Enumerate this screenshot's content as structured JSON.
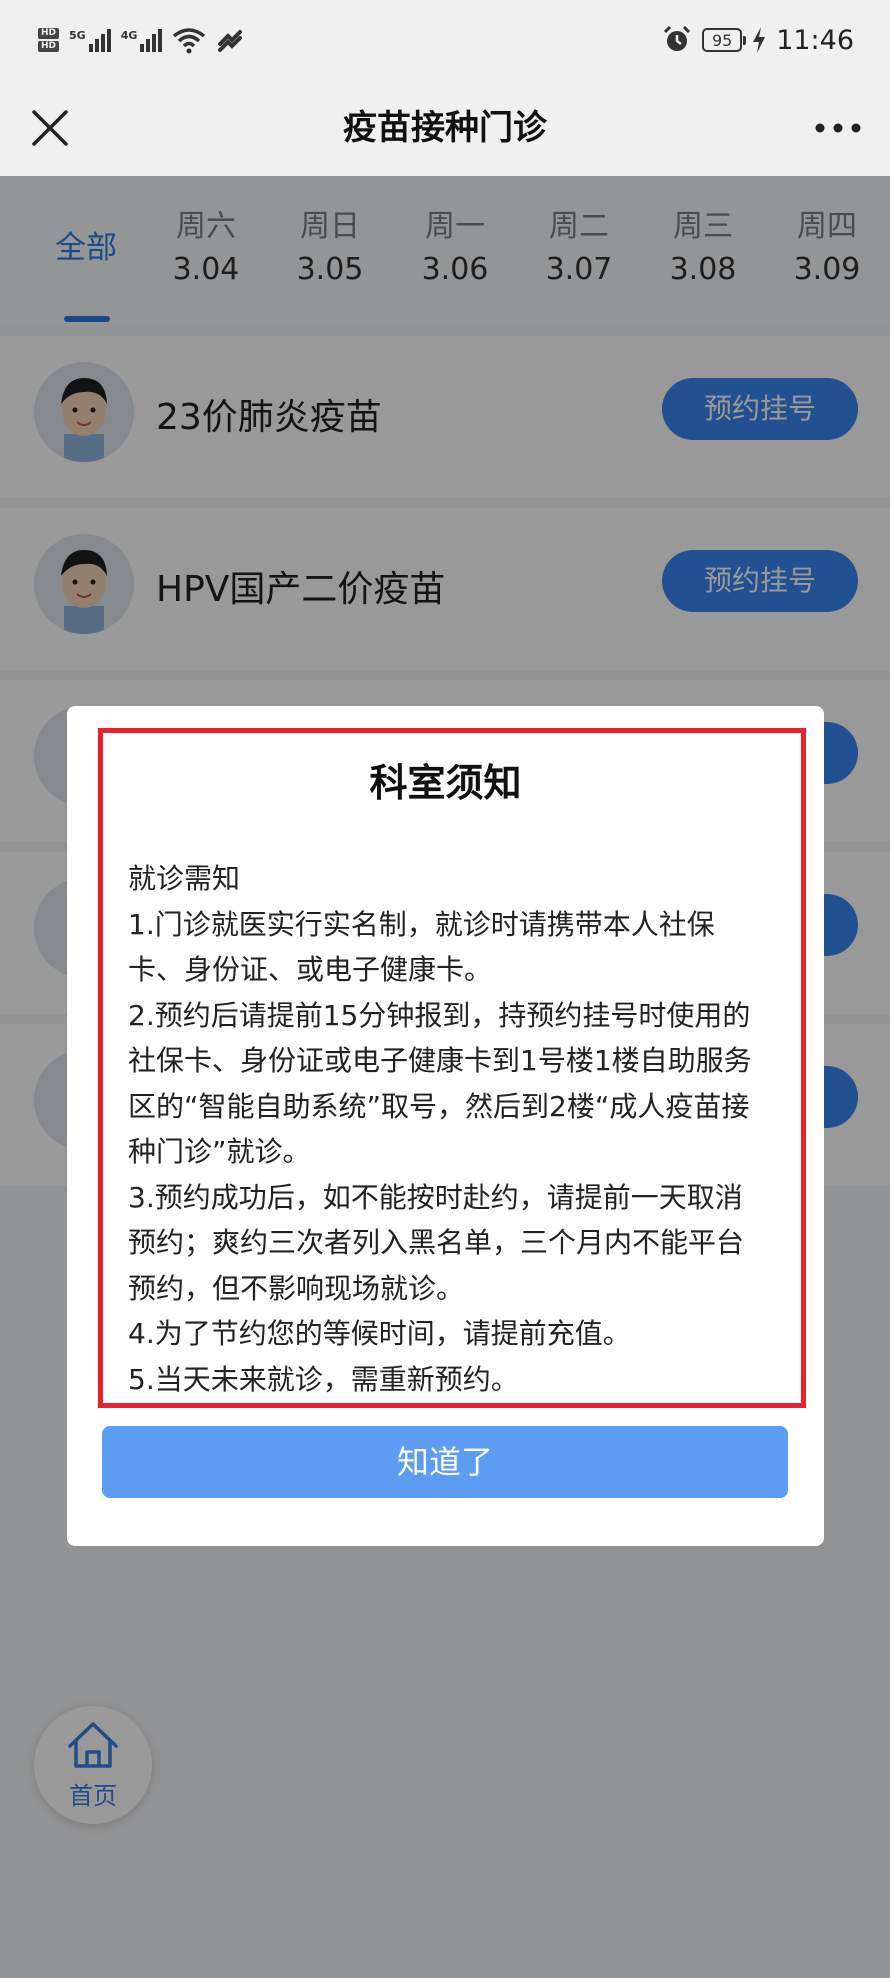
{
  "status_bar": {
    "sim1": "HD",
    "sim2": "HD",
    "net1": "5G",
    "net2": "4G",
    "battery": "95",
    "time": "11:46"
  },
  "header": {
    "title": "疫苗接种门诊"
  },
  "date_tabs": {
    "all_label": "全部",
    "days": [
      {
        "weekday": "周六",
        "date": "3.04"
      },
      {
        "weekday": "周日",
        "date": "3.05"
      },
      {
        "weekday": "周一",
        "date": "3.06"
      },
      {
        "weekday": "周二",
        "date": "3.07"
      },
      {
        "weekday": "周三",
        "date": "3.08"
      },
      {
        "weekday": "周四",
        "date": "3.09"
      }
    ]
  },
  "vaccines": [
    {
      "name": "23价肺炎疫苗",
      "button": "预约挂号"
    },
    {
      "name": "HPV国产二价疫苗",
      "button": "预约挂号"
    }
  ],
  "home_nav": {
    "label": "首页"
  },
  "modal": {
    "title": "科室须知",
    "lines": [
      "就诊需知",
      "1.门诊就医实行实名制，就诊时请携带本人社保卡、身份证、或电子健康卡。",
      "2.预约后请提前15分钟报到，持预约挂号时使用的社保卡、身份证或电子健康卡到1号楼1楼自助服务区的“智能自助系统”取号，然后到2楼“成人疫苗接种门诊”就诊。",
      "3.预约成功后，如不能按时赴约，请提前一天取消预约；爽约三次者列入黑名单，三个月内不能平台预约，但不影响现场就诊。",
      "4.为了节约您的等候时间，请提前充值。",
      "5.当天未来就诊，需重新预约。"
    ],
    "confirm_button": "知道了"
  },
  "colors": {
    "accent": "#2f7be5",
    "button": "#3a86f0",
    "confirm": "#5c9cf3",
    "highlight_border": "#e8212c"
  }
}
